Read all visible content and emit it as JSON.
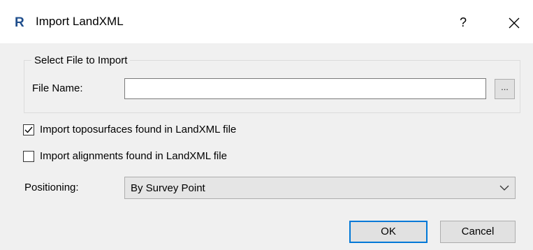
{
  "window": {
    "title": "Import LandXML",
    "app_icon": "revit-r-icon",
    "help_label": "?",
    "close_icon": "close-icon"
  },
  "file_group": {
    "legend": "Select File to Import",
    "file_name_label": "File Name:",
    "file_name_value": "",
    "browse_label": "..."
  },
  "options": {
    "toposurfaces": {
      "label": "Import toposurfaces found in LandXML file",
      "checked": true
    },
    "alignments": {
      "label": "Import alignments found in LandXML file",
      "checked": false
    }
  },
  "positioning": {
    "label": "Positioning:",
    "selected": "By Survey Point",
    "chevron_icon": "chevron-down-icon"
  },
  "buttons": {
    "ok": "OK",
    "cancel": "Cancel"
  },
  "colors": {
    "accent": "#0078d7",
    "app_icon": "#1f4e8c",
    "dialog_bg": "#f0f0f0",
    "titlebar_bg": "#ffffff"
  }
}
